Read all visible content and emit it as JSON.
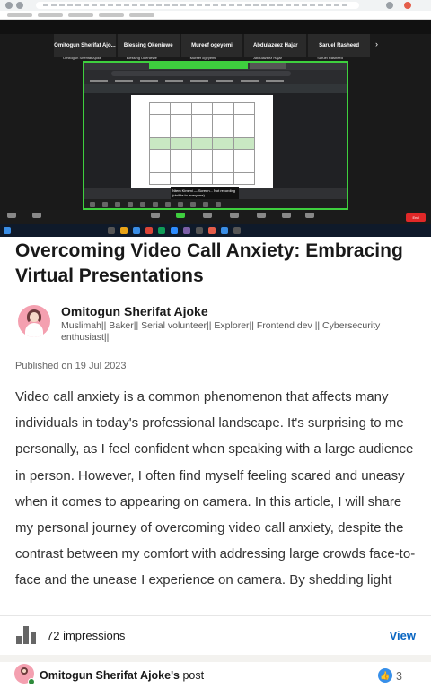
{
  "screenshot": {
    "participants": [
      "Omitogun Sherifat Ajo...",
      "Blessing Okeniewe",
      "Mureef ogeyemi",
      "Abdulazeez Hajar",
      "Saruel Rasheed"
    ],
    "participant_names": [
      "Omitogun Sherifat Ajoke",
      "Blessing Okeniewe",
      "Mureef ogeyemi",
      "Abdulazeez Hajar",
      "Saruel Rasheed"
    ],
    "footer_overlay": "Ntem Kinsmi — Screen... Not recording (visible to everyone)",
    "end_label": "End"
  },
  "article": {
    "title": "Overcoming Video Call Anxiety: Embracing Virtual Presentations",
    "author": {
      "name": "Omitogun Sherifat Ajoke",
      "bio": "Muslimah|| Baker|| Serial volunteer|| Explorer|| Frontend dev || Cybersecurity enthusiast||"
    },
    "published": "Published on 19 Jul 2023",
    "body": "Video call anxiety is a common phenomenon that affects many individuals in today's professional landscape. It's surprising to me personally, as I feel confident when speaking with a large audience in person. However, I often find myself feeling scared and uneasy when it comes to appearing on camera. In this article, I will share my personal journey of overcoming video call anxiety, despite the contrast between my comfort with addressing large crowds face-to-face and the unease I experience on camera. By shedding light"
  },
  "footer": {
    "impressions": "72 impressions",
    "view_label": "View",
    "post_owner": "Omitogun Sherifat Ajoke's",
    "post_suffix": " post",
    "like_count": "3"
  },
  "colors": {
    "accent": "#0a66c2",
    "share_border": "#3ecf3e",
    "end_button": "#e02828",
    "online": "#2e8b3a"
  },
  "icons": [
    "chart-icon",
    "like-icon",
    "avatar",
    "online-status-icon"
  ]
}
